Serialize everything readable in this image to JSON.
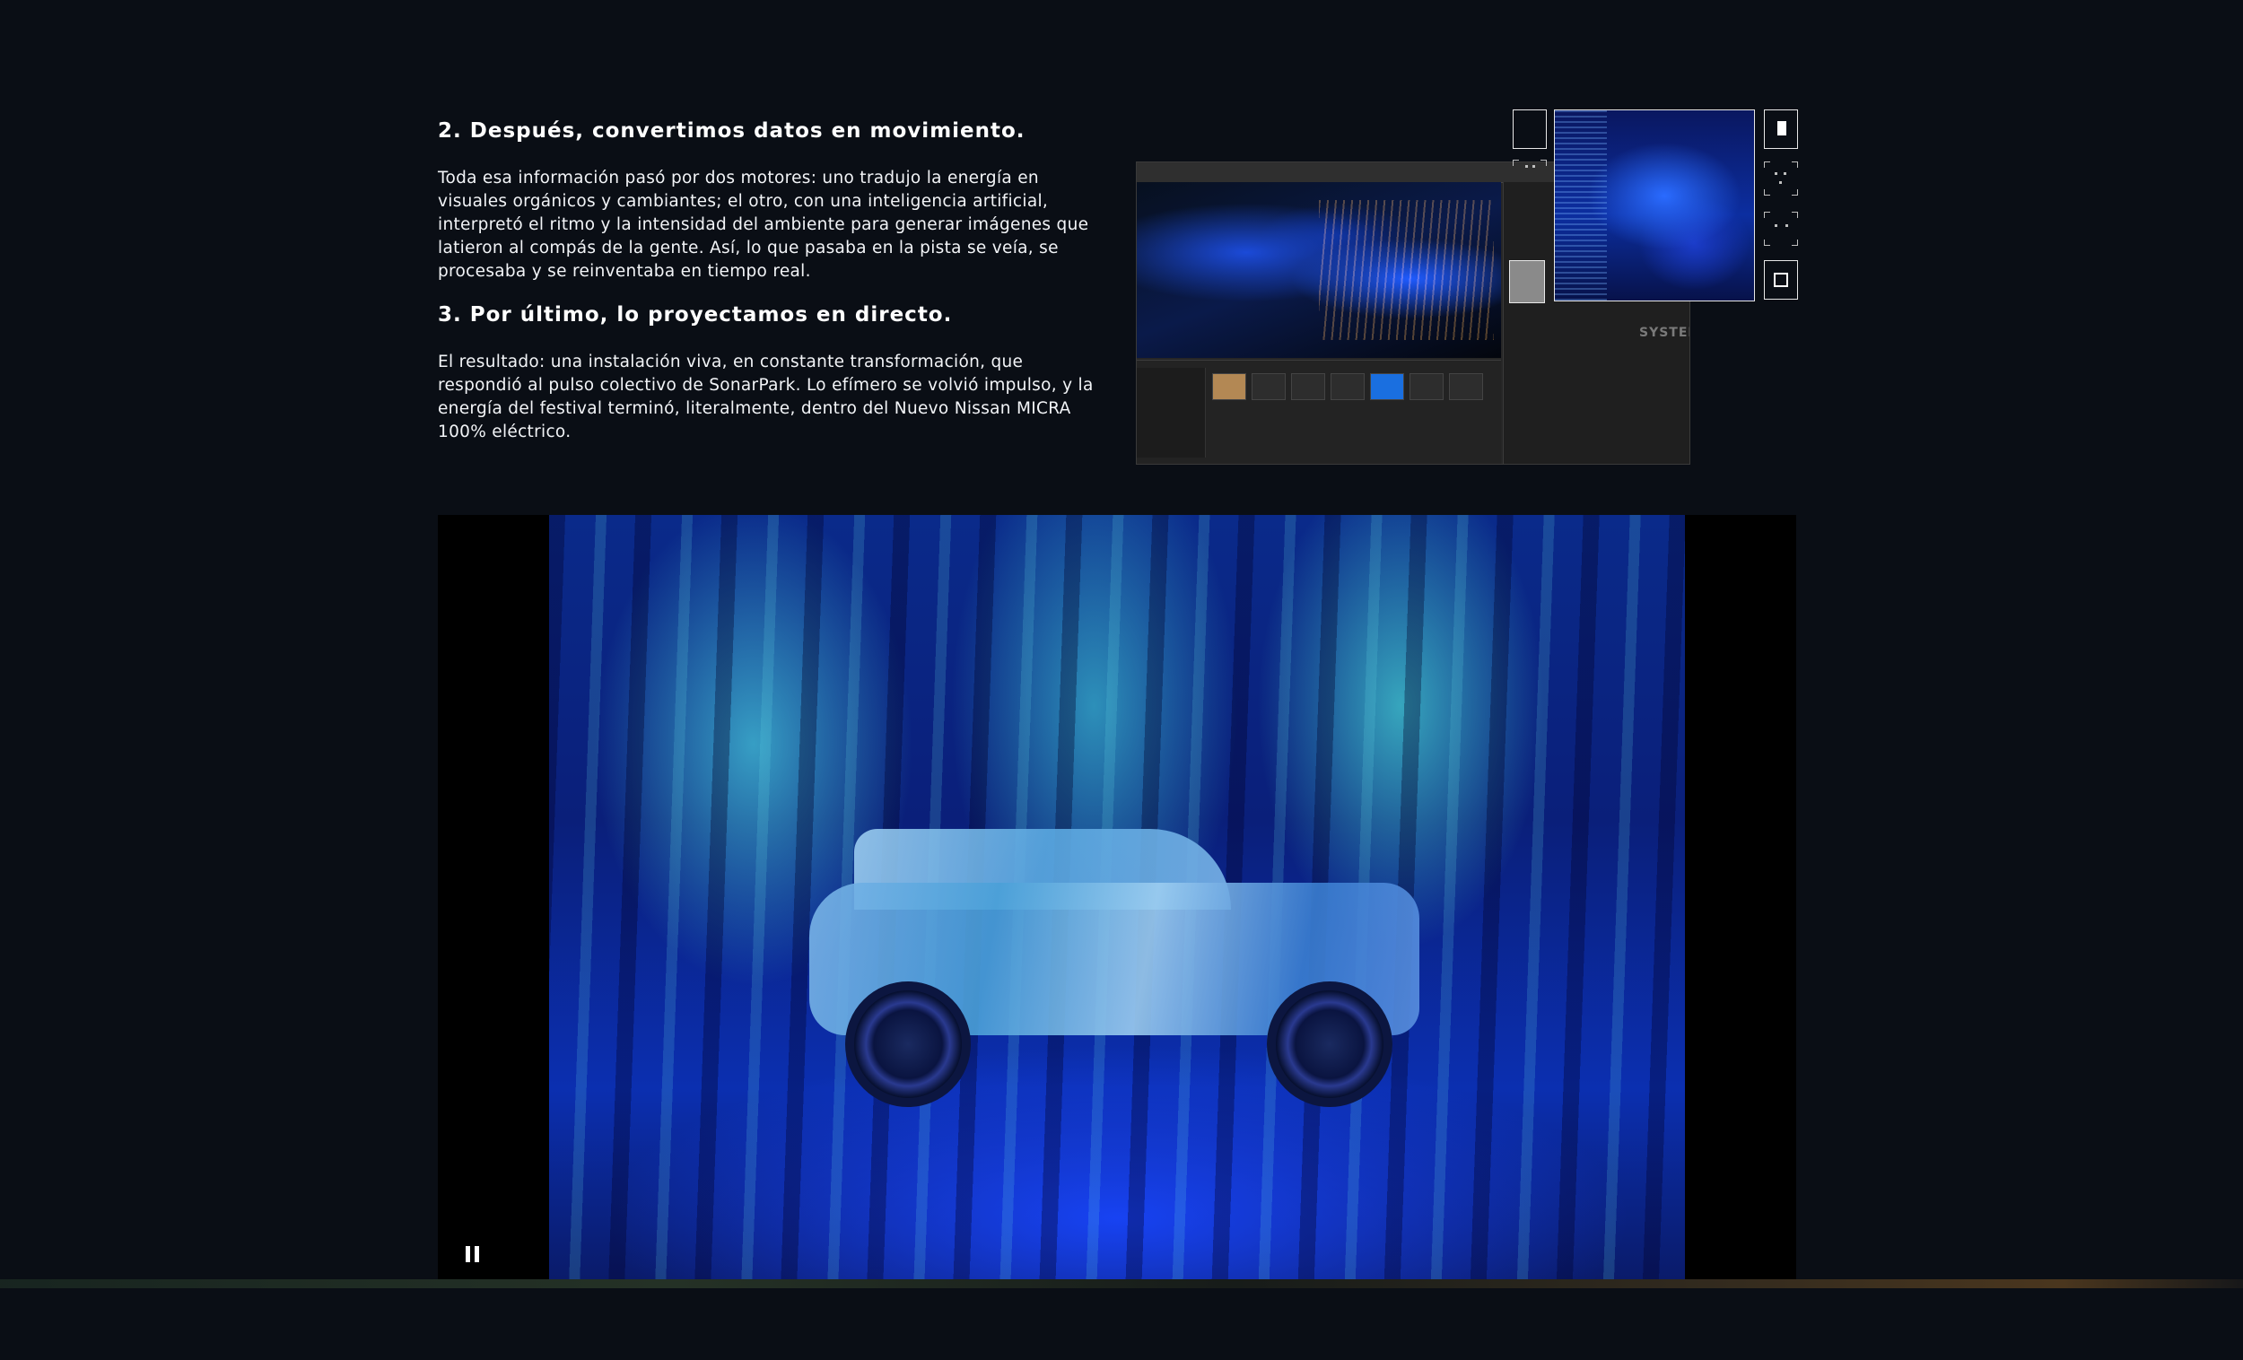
{
  "steps": [
    {
      "heading": "2. Después, convertimos datos en movimiento.",
      "body": "Toda esa información pasó por dos motores: uno tradujo la energía en visuales orgánicos y cambiantes; el otro, con una inteligencia artificial, interpretó el ritmo y la intensidad del ambiente para generar imágenes que latieron al compás de la gente. Así, lo que pasaba en la pista se veía, se procesaba y se reinventaba en tiempo real."
    },
    {
      "heading": "3. Por último, lo proyectamos en directo.",
      "body": "El resultado: una instalación viva, en constante transformación, que respondió al pulso colectivo de SonarPark. Lo efímero se volvió impulso, y la energía del festival terminó, literalmente, dentro del Nuevo Nissan MICRA 100% eléctrico."
    }
  ],
  "collage": {
    "editor_watermark": "SYSTEM"
  },
  "video": {
    "state": "playing",
    "control_icon": "pause-icon"
  },
  "colors": {
    "background": "#0a0e15",
    "text": "#ffffff",
    "accent_blue": "#1a6fe0"
  }
}
